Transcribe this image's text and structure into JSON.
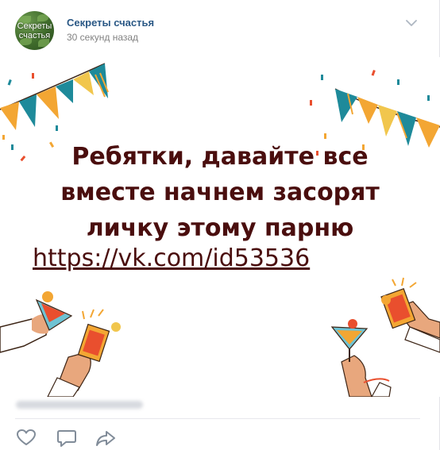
{
  "post": {
    "author": "Секреты счастья",
    "time": "30 секунд назад",
    "avatar_text_line1": "Секреты",
    "avatar_text_line2": "счастья",
    "image_text": {
      "line1": "Ребятки, давайте все",
      "line2": "вместе начнем засорят",
      "line3": "личку этому парню",
      "link": "https://vk.com/id53536"
    }
  },
  "colors": {
    "text_dark_red": "#4a0e0e",
    "link_blue": "#2a5885",
    "muted": "#828282",
    "icon": "#818c99"
  },
  "icons": {
    "menu": "chevron-down-icon",
    "like": "heart-icon",
    "comment": "comment-icon",
    "share": "share-icon"
  }
}
